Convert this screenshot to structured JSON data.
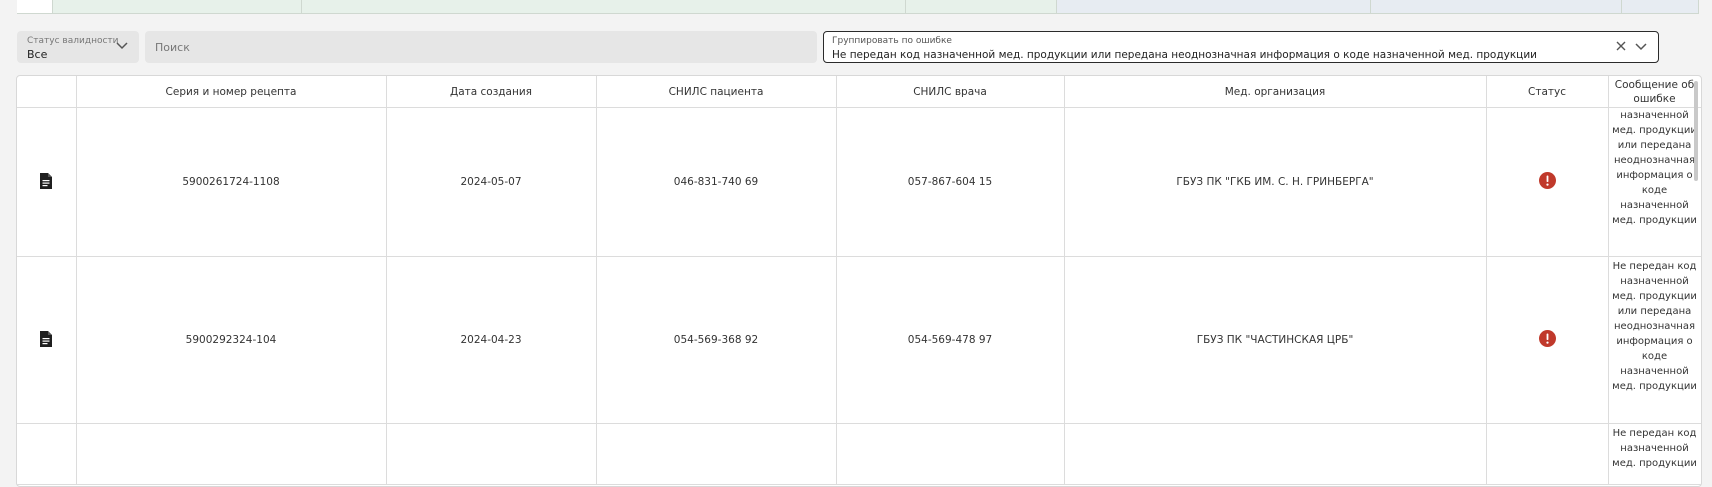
{
  "filters": {
    "status": {
      "label": "Статус валидности",
      "value": "Все"
    },
    "search": {
      "placeholder": "Поиск"
    },
    "group": {
      "label": "Группировать по ошибке",
      "value": "Не передан код назначенной мед. продукции или передана неоднозначная информация о коде назначенной мед. продукции"
    }
  },
  "table": {
    "columns": [
      "",
      "Серия и номер рецепта",
      "Дата создания",
      "СНИЛС пациента",
      "СНИЛС врача",
      "Мед. организация",
      "Статус",
      "Сообщение об ошибке"
    ],
    "rows": [
      {
        "number": "5900261724-1108",
        "date": "2024-05-07",
        "patient_snils": "046-831-740 69",
        "doctor_snils": "057-867-604 15",
        "organization": "ГБУЗ ПК \"ГКБ ИМ. С. Н. ГРИНБЕРГА\"",
        "message": "назначенной мед. продукции или передана неоднозначная информация о коде назначенной мед. продукции"
      },
      {
        "number": "5900292324-104",
        "date": "2024-04-23",
        "patient_snils": "054-569-368 92",
        "doctor_snils": "054-569-478 97",
        "organization": "ГБУЗ ПК \"ЧАСТИНСКАЯ ЦРБ\"",
        "message": "Не передан код назначенной мед. продукции или передана неоднозначная информация о коде назначенной мед. продукции"
      },
      {
        "number": "",
        "date": "",
        "patient_snils": "",
        "doctor_snils": "",
        "organization": "",
        "message": "Не передан код назначенной мед. продукции"
      }
    ]
  },
  "colors": {
    "error": "#c0392b",
    "border_active": "#2b2b2b"
  },
  "icons": {
    "row_icon": "document-icon",
    "status_icon": "error-icon"
  }
}
